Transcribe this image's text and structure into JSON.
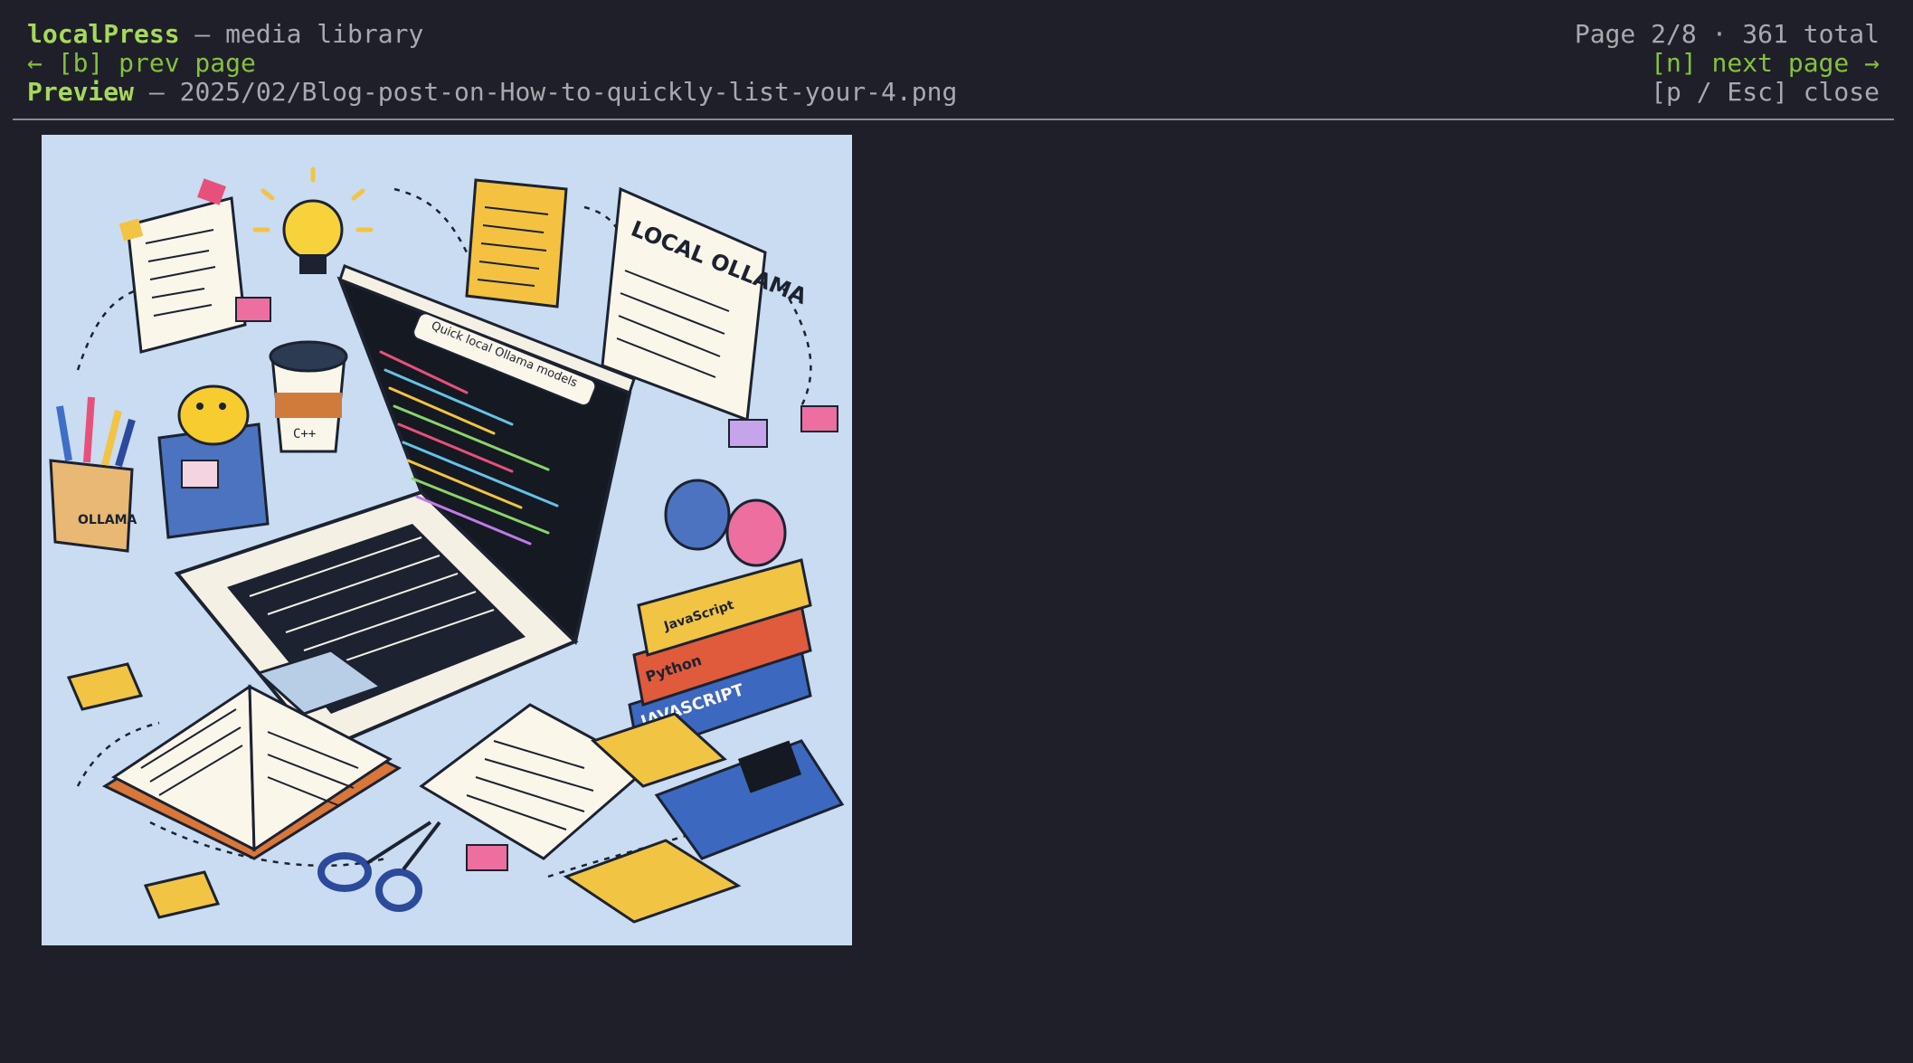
{
  "header": {
    "app_name": "localPress",
    "separator": " — ",
    "section": "media library",
    "page_info": "Page 2/8 · 361 total",
    "prev_label": "← [b] prev page",
    "next_label": "[n] next page →",
    "preview_label": "Preview",
    "preview_path": "2025/02/Blog-post-on-How-to-quickly-list-your-4.png",
    "close_label": "[p / Esc] close"
  },
  "preview": {
    "alt": "Illustration: laptop with code, books, notes and desk supplies",
    "note_title": "LOCAL OLLAMA",
    "search_text": "Quick local Ollama models",
    "book_top": "JavaScript",
    "book_mid": "Python",
    "book_bot": "JAVASCRIPT",
    "box_label": "OLLAMA",
    "cup_label": "C++"
  },
  "colors": {
    "background": "#1f1f2a",
    "accent_green": "#a6d95a",
    "key_green": "#84c23c",
    "muted_text": "#a9a9ad",
    "canvas_blue": "#c9dcf1"
  }
}
